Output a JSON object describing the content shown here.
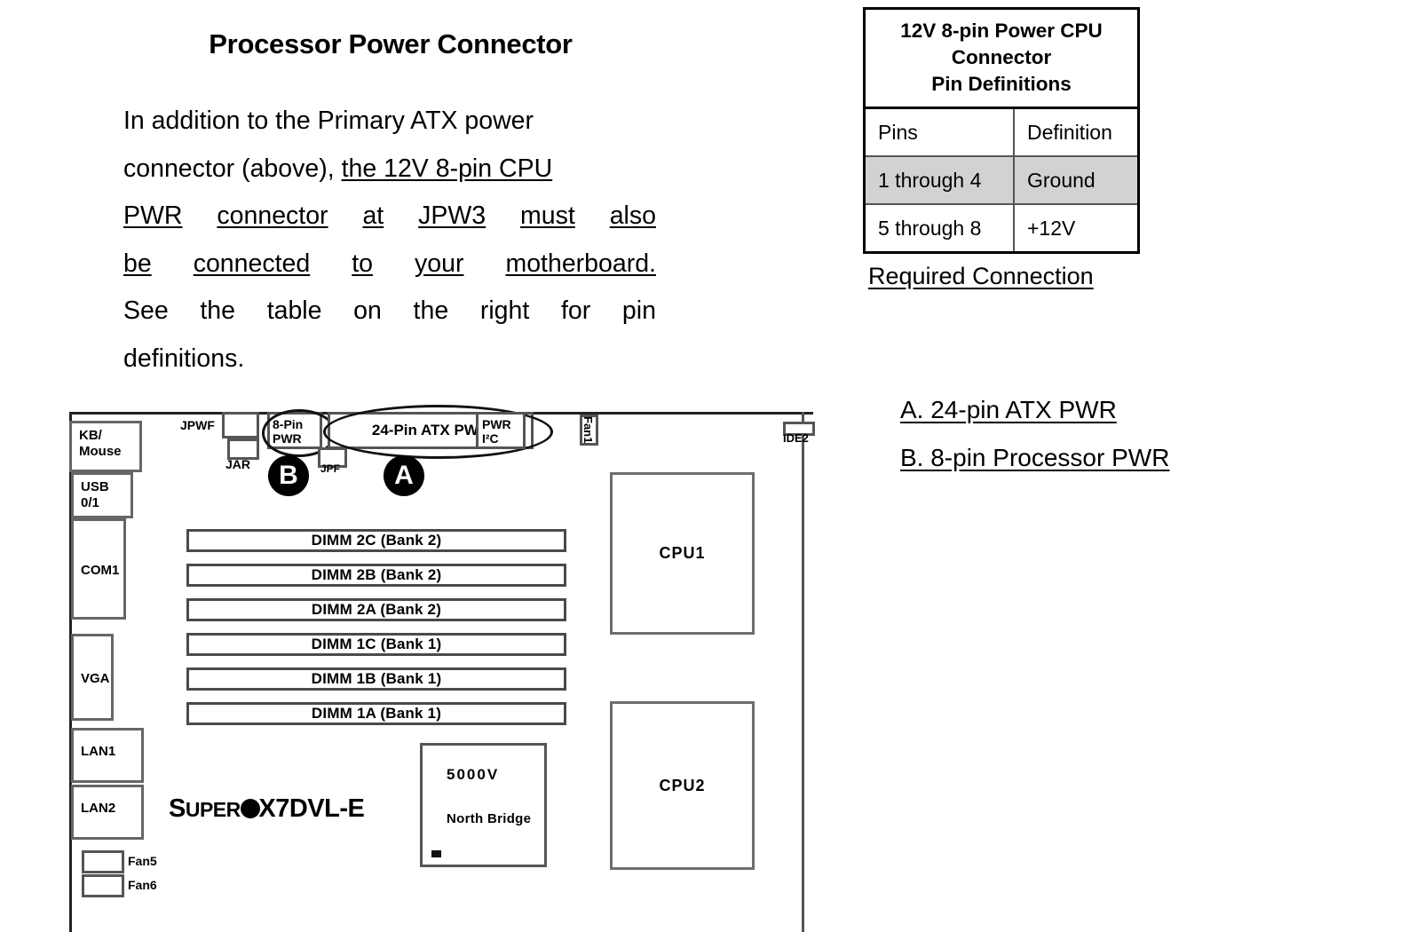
{
  "page": {
    "title": "Processor Power Connector",
    "paragraph_lines": [
      {
        "segments": [
          {
            "text": "In addition to the Primary ATX power",
            "underline": false
          }
        ],
        "justify": false
      },
      {
        "segments": [
          {
            "text": "connector (above), ",
            "underline": false
          },
          {
            "text": "the 12V 8-pin CPU",
            "underline": true
          }
        ],
        "justify": false
      },
      {
        "segments": [
          {
            "text": "PWR",
            "underline": true
          },
          {
            "text": "connector",
            "underline": true
          },
          {
            "text": "at",
            "underline": true
          },
          {
            "text": "JPW3",
            "underline": true
          },
          {
            "text": "must",
            "underline": true
          },
          {
            "text": "also",
            "underline": true
          }
        ],
        "justify": true
      },
      {
        "segments": [
          {
            "text": "be",
            "underline": true
          },
          {
            "text": "connected",
            "underline": true
          },
          {
            "text": "to",
            "underline": true
          },
          {
            "text": "your",
            "underline": true
          },
          {
            "text": "motherboard.",
            "underline": true
          }
        ],
        "justify": true
      },
      {
        "segments": [
          {
            "text": "See",
            "underline": false
          },
          {
            "text": "the",
            "underline": false
          },
          {
            "text": "table",
            "underline": false
          },
          {
            "text": "on",
            "underline": false
          },
          {
            "text": "the",
            "underline": false
          },
          {
            "text": "right",
            "underline": false
          },
          {
            "text": "for",
            "underline": false
          },
          {
            "text": "pin",
            "underline": false
          }
        ],
        "justify": true
      },
      {
        "segments": [
          {
            "text": "definitions.",
            "underline": false
          }
        ],
        "justify": false
      }
    ]
  },
  "pin_table": {
    "caption_line1": "12V 8-pin  Power CPU",
    "caption_line2": "Connector",
    "caption_line3": "Pin Definitions",
    "headers": {
      "pins": "Pins",
      "definition": "Definition"
    },
    "rows": [
      {
        "pins": "1 through 4",
        "definition": "Ground",
        "shaded": true
      },
      {
        "pins": "5 through 8",
        "definition": "+12V",
        "shaded": false
      }
    ],
    "footnote": "Required Connection",
    "shaded_color": "#d2d2d2"
  },
  "legend": {
    "items": [
      {
        "label": "A. 24-pin ATX PWR"
      },
      {
        "label": "B. 8-pin Processor PWR"
      }
    ]
  },
  "board": {
    "model_logo": {
      "prefix_s": "S",
      "prefix_rest": "UPER",
      "registered": "®",
      "model": "X7DVL-E"
    },
    "io_ports": [
      {
        "label_line1": "KB/",
        "label_line2": "Mouse"
      },
      {
        "label_line1": "USB 0/1",
        "label_line2": ""
      },
      {
        "label_line1": "COM1",
        "label_line2": ""
      },
      {
        "label_line1": "VGA",
        "label_line2": ""
      },
      {
        "label_line1": "LAN1",
        "label_line2": ""
      },
      {
        "label_line1": "LAN2",
        "label_line2": ""
      }
    ],
    "fan_headers": [
      {
        "label": "Fan5"
      },
      {
        "label": "Fan6"
      }
    ],
    "top_connectors": {
      "jpwf": "JPWF",
      "jar": "JAR",
      "pwr_8pin_line1": "8-Pin",
      "pwr_8pin_line2": "PWR",
      "jpf": "JPF",
      "atx_24pin": "24-Pin ATX PWR",
      "pwr_i2c_line1": "PWR",
      "pwr_i2c_line2": "I²C",
      "fan1": "Fan1",
      "ide2": "IDE2"
    },
    "markers": [
      {
        "label": "B"
      },
      {
        "label": "A"
      }
    ],
    "dimm_slots": [
      {
        "label": "DIMM 2C (Bank 2)"
      },
      {
        "label": "DIMM 2B (Bank 2)"
      },
      {
        "label": "DIMM 2A (Bank 2)"
      },
      {
        "label": "DIMM 1C (Bank 1)"
      },
      {
        "label": "DIMM 1B (Bank 1)"
      },
      {
        "label": "DIMM 1A (Bank 1)"
      }
    ],
    "cpus": [
      {
        "label": "CPU1"
      },
      {
        "label": "CPU2"
      }
    ],
    "north_bridge": {
      "model": "5000V",
      "name": "North Bridge"
    }
  }
}
